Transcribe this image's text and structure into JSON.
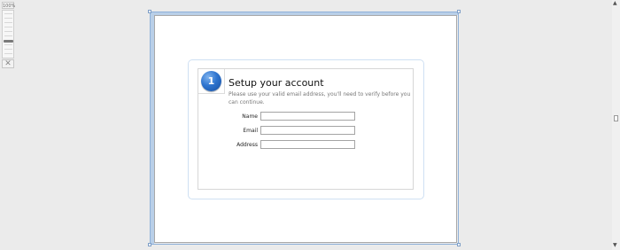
{
  "zoom": {
    "label": "100%",
    "level_percent": 100
  },
  "zoom_close_glyph": "✕",
  "form": {
    "step_number": "1",
    "title": "Setup your account",
    "subtitle": "Please use your valid email address, you'll need to verify before you can continue.",
    "fields": [
      {
        "label": "Name",
        "value": ""
      },
      {
        "label": "Email",
        "value": ""
      },
      {
        "label": "Address",
        "value": ""
      }
    ]
  },
  "scrollbar": {
    "up_arrow": "▲",
    "down_arrow": "▼"
  },
  "colors": {
    "background": "#ebebeb",
    "selection": "#8fb1d9",
    "accent": "#2e74cf"
  }
}
